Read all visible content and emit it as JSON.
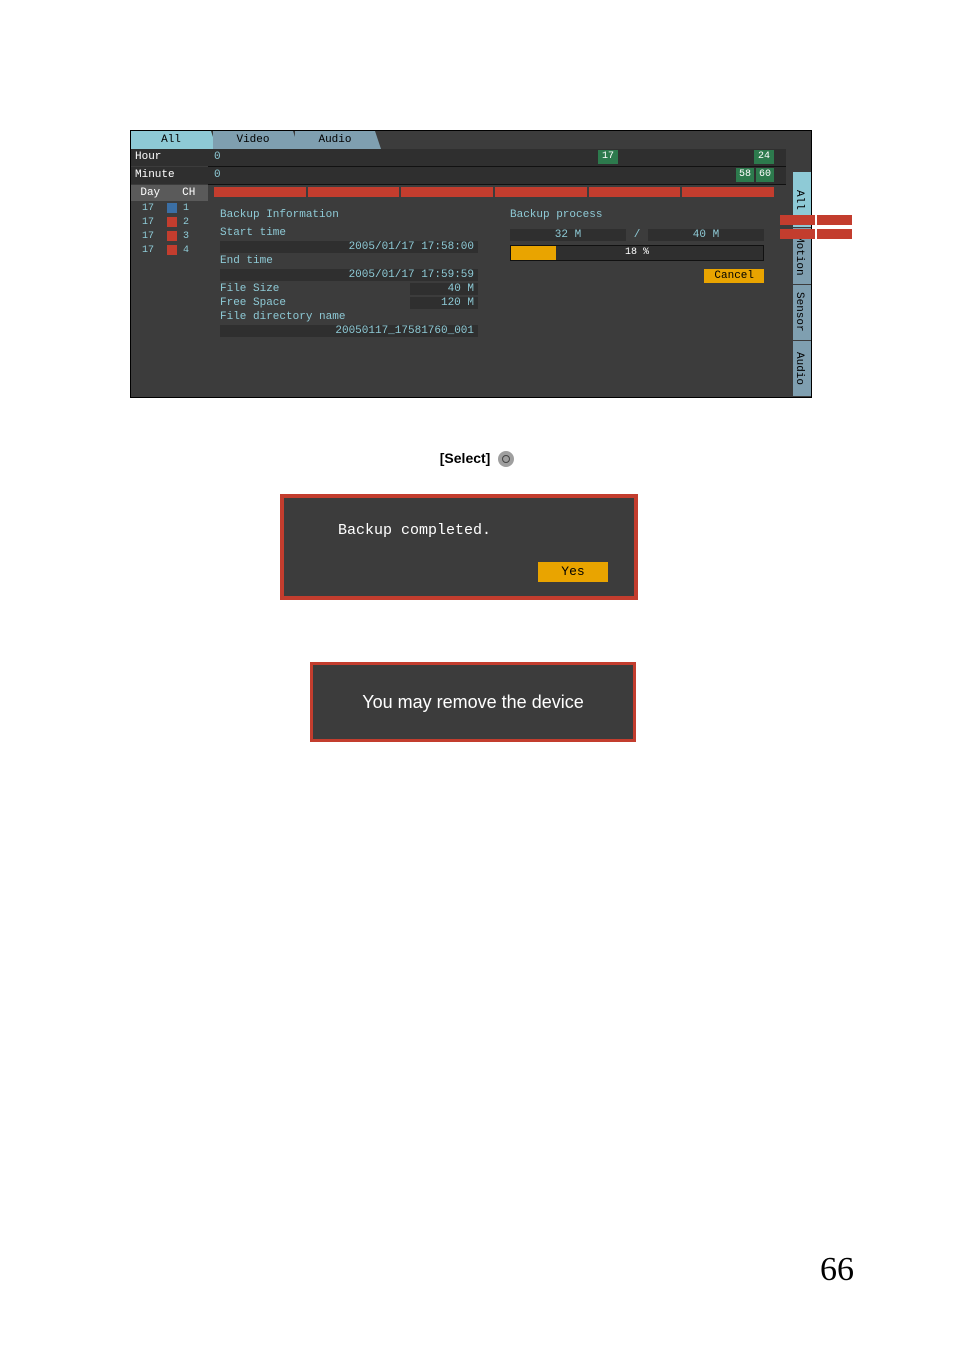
{
  "tabs_top": {
    "all": "All",
    "video": "Video",
    "audio": "Audio"
  },
  "tabs_right": {
    "all": "All",
    "motion": "Motion",
    "sensor": "Sensor",
    "audio": "Audio"
  },
  "ruler": {
    "hour_label": "Hour",
    "minute_label": "Minute",
    "zero": "0",
    "hour_marker_a": "17",
    "hour_marker_b": "24",
    "minute_marker_a": "58",
    "minute_marker_b": "60"
  },
  "dc": {
    "day": "Day",
    "ch": "CH"
  },
  "channels": [
    {
      "day": "17",
      "num": "1"
    },
    {
      "day": "17",
      "num": "2"
    },
    {
      "day": "17",
      "num": "3"
    },
    {
      "day": "17",
      "num": "4"
    }
  ],
  "backup_info": {
    "title": "Backup Information",
    "start_label": "Start time",
    "start_val": "2005/01/17  17:58:00",
    "end_label": "End time",
    "end_val": "2005/01/17  17:59:59",
    "size_label": "File Size",
    "size_val": "40 M",
    "free_label": "Free Space",
    "free_val": "120 M",
    "dir_label": "File directory name",
    "dir_val": "20050117_17581760_001"
  },
  "process": {
    "title": "Backup process",
    "current": "32 M",
    "slash": "/",
    "total": "40 M",
    "percent_text": "18 %",
    "percent": 18,
    "cancel": "Cancel"
  },
  "select_label": "[Select]",
  "dlg1": {
    "text": "Backup completed.",
    "yes": "Yes"
  },
  "dlg2": {
    "text": "You may remove the device"
  },
  "page_number": "66"
}
